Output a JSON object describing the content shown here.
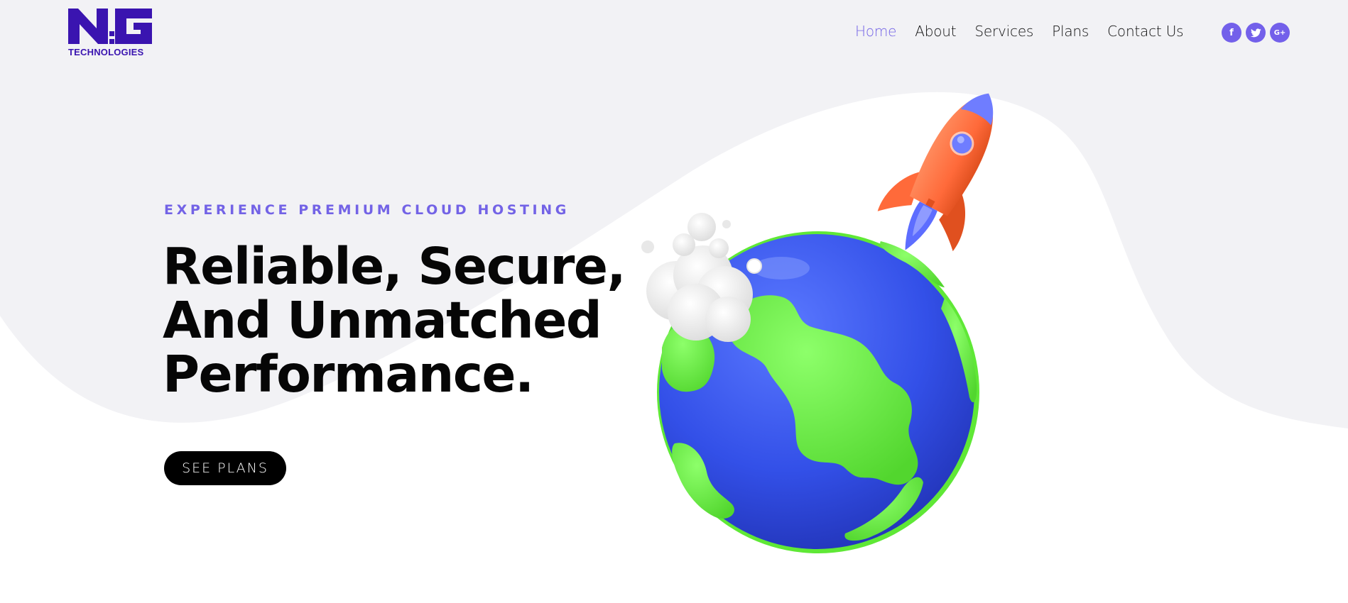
{
  "brand": {
    "logo_text": "TECHNOLOGIES",
    "logo_mark": "NG",
    "color": "#3a14b0"
  },
  "nav": {
    "items": [
      {
        "label": "Home",
        "active": true
      },
      {
        "label": "About",
        "active": false
      },
      {
        "label": "Services",
        "active": false
      },
      {
        "label": "Plans",
        "active": false
      },
      {
        "label": "Contact Us",
        "active": false
      }
    ]
  },
  "social": {
    "items": [
      {
        "icon": "facebook-icon",
        "glyph": "f"
      },
      {
        "icon": "twitter-icon",
        "glyph": ""
      },
      {
        "icon": "google-plus-icon",
        "glyph": "G+"
      }
    ],
    "color": "#7360ea"
  },
  "hero": {
    "subtitle": "EXPERIENCE PREMIUM CLOUD HOSTING",
    "title_lines": [
      "Reliable, Secure,",
      "And Unmatched",
      "Performance."
    ],
    "cta_label": "SEE PLANS"
  },
  "colors": {
    "accent": "#7363e6",
    "background_band": "#f2f2f5",
    "globe_ocean": "#3350e8",
    "globe_land": "#6ef540",
    "rocket": "#ff6a3a"
  },
  "illustration": {
    "elements": [
      "globe-illustration",
      "rocket-illustration",
      "cloud-illustration"
    ]
  }
}
